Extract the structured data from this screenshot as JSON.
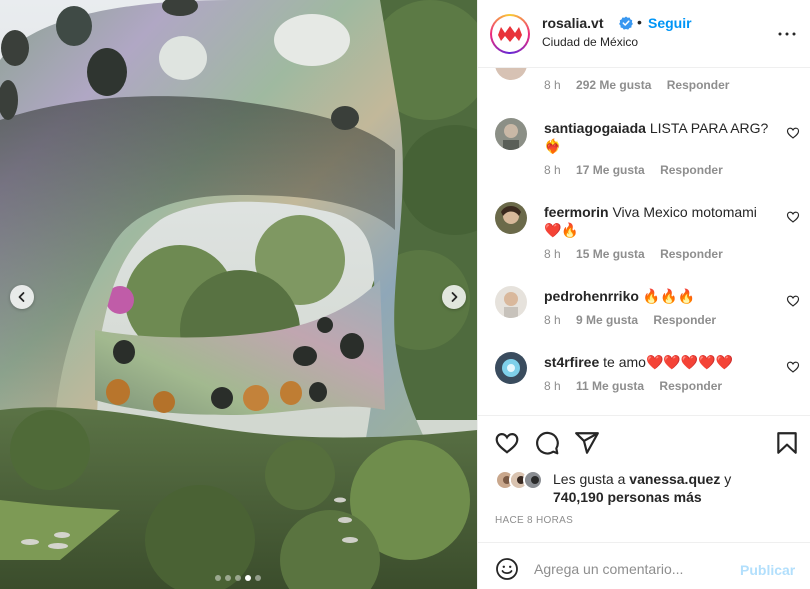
{
  "post": {
    "username": "rosalia.vt",
    "separator": "•",
    "follow_label": "Seguir",
    "location": "Ciudad de México"
  },
  "media": {
    "carousel_count": 5,
    "active_index": 3
  },
  "comments": [
    {
      "username": "",
      "text": "",
      "time": "8 h",
      "likes": "292 Me gusta",
      "reply": "Responder"
    },
    {
      "username": "santiagogaiada",
      "text": "LISTA PARA ARG? ❤️‍🔥",
      "time": "8 h",
      "likes": "17 Me gusta",
      "reply": "Responder"
    },
    {
      "username": "feermorin",
      "text": "Viva Mexico motomami ❤️🔥",
      "time": "8 h",
      "likes": "15 Me gusta",
      "reply": "Responder"
    },
    {
      "username": "pedrohenrriko",
      "text": "🔥🔥🔥",
      "time": "8 h",
      "likes": "9 Me gusta",
      "reply": "Responder"
    },
    {
      "username": "st4rfiree",
      "text": "te amo❤️❤️❤️❤️❤️",
      "time": "8 h",
      "likes": "11 Me gusta",
      "reply": "Responder"
    }
  ],
  "likes": {
    "prefix": "Les gusta a",
    "user": "vanessa.quez",
    "suffix": "y",
    "others": "740,190 personas más"
  },
  "timestamp": "HACE 8 HORAS",
  "composer": {
    "placeholder": "Agrega un comentario...",
    "publish_label": "Publicar"
  },
  "icons": {
    "verified": "verified-badge-icon",
    "more": "more-options-icon",
    "like": "heart-icon",
    "comment": "comment-icon",
    "share": "share-icon",
    "save": "bookmark-icon",
    "emoji": "emoji-icon",
    "prev": "chevron-left-icon",
    "next": "chevron-right-icon"
  },
  "colors": {
    "accent": "#0095f6",
    "accent_disabled": "#b2dffc",
    "muted": "#8e8e8e",
    "text": "#262626",
    "border": "#efefef"
  }
}
